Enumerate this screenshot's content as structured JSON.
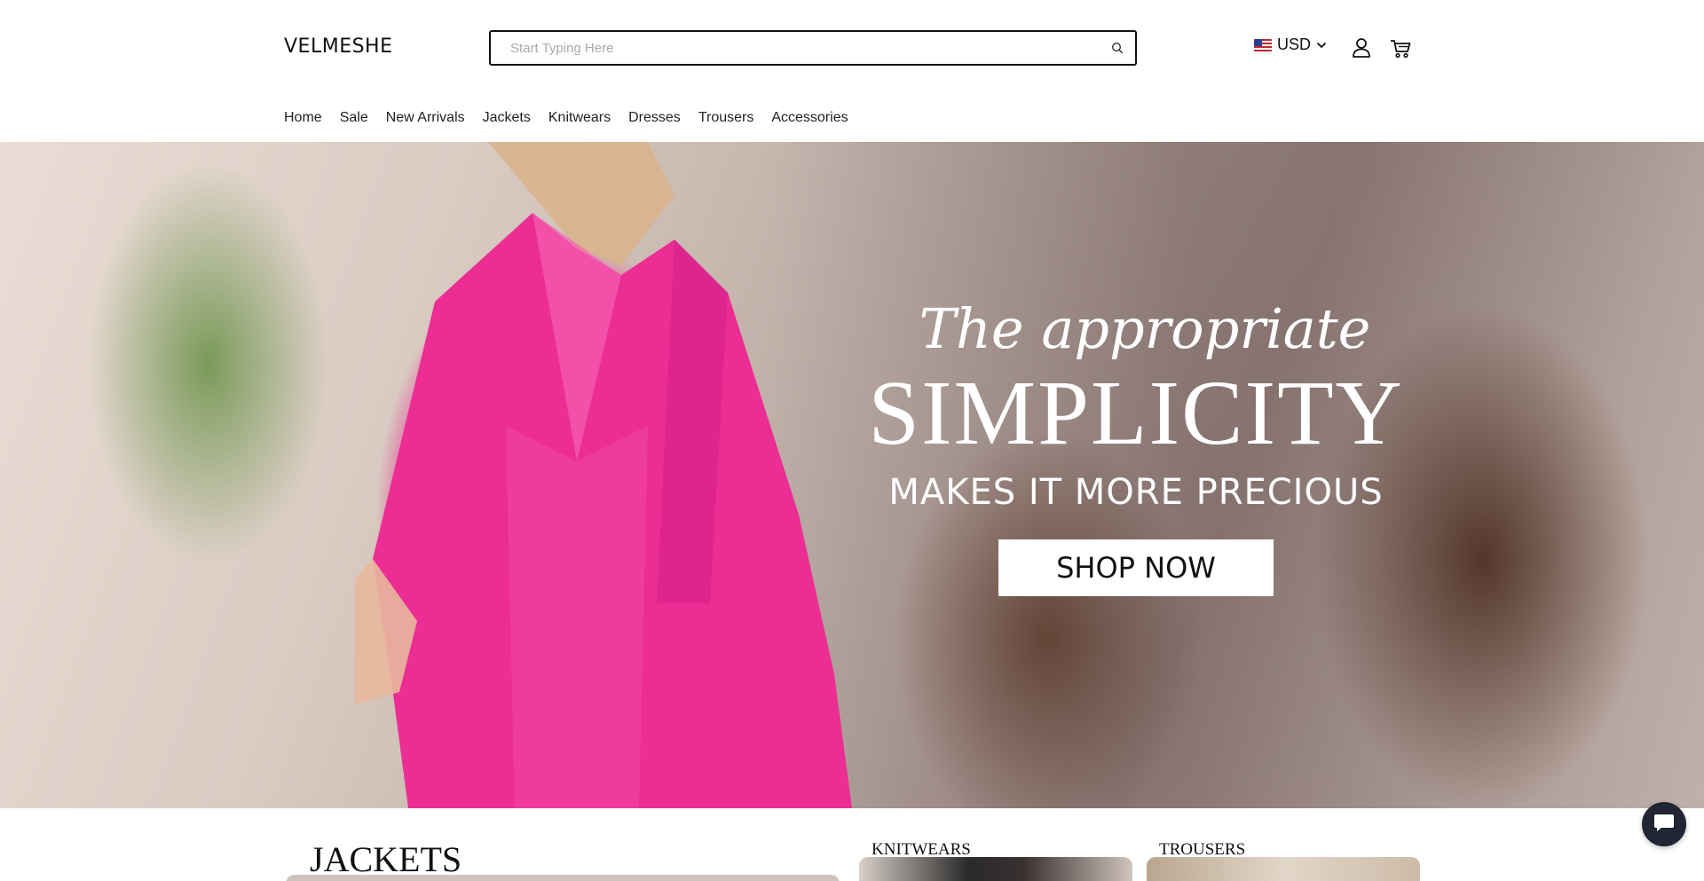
{
  "header": {
    "logo": "VELMESHE",
    "search": {
      "placeholder": "Start Typing Here",
      "value": ""
    },
    "currency": {
      "label": "USD",
      "flag": "us-flag-icon"
    },
    "icons": {
      "search": "search-icon",
      "account": "user-icon",
      "cart": "cart-icon"
    }
  },
  "nav": {
    "items": [
      {
        "label": "Home"
      },
      {
        "label": "Sale"
      },
      {
        "label": "New Arrivals"
      },
      {
        "label": "Jackets"
      },
      {
        "label": "Knitwears"
      },
      {
        "label": "Dresses"
      },
      {
        "label": "Trousers"
      },
      {
        "label": "Accessories"
      }
    ]
  },
  "hero": {
    "script_line": "The appropriate",
    "headline": "SIMPLICITY",
    "subline": "MAKES IT MORE PRECIOUS",
    "cta": "SHOP NOW",
    "accent_color": "#ec2d94"
  },
  "categories": [
    {
      "label": "JACKETS"
    },
    {
      "label": "KNITWEARS"
    },
    {
      "label": "TROUSERS"
    }
  ],
  "chat": {
    "icon": "chat-bubble-icon"
  }
}
